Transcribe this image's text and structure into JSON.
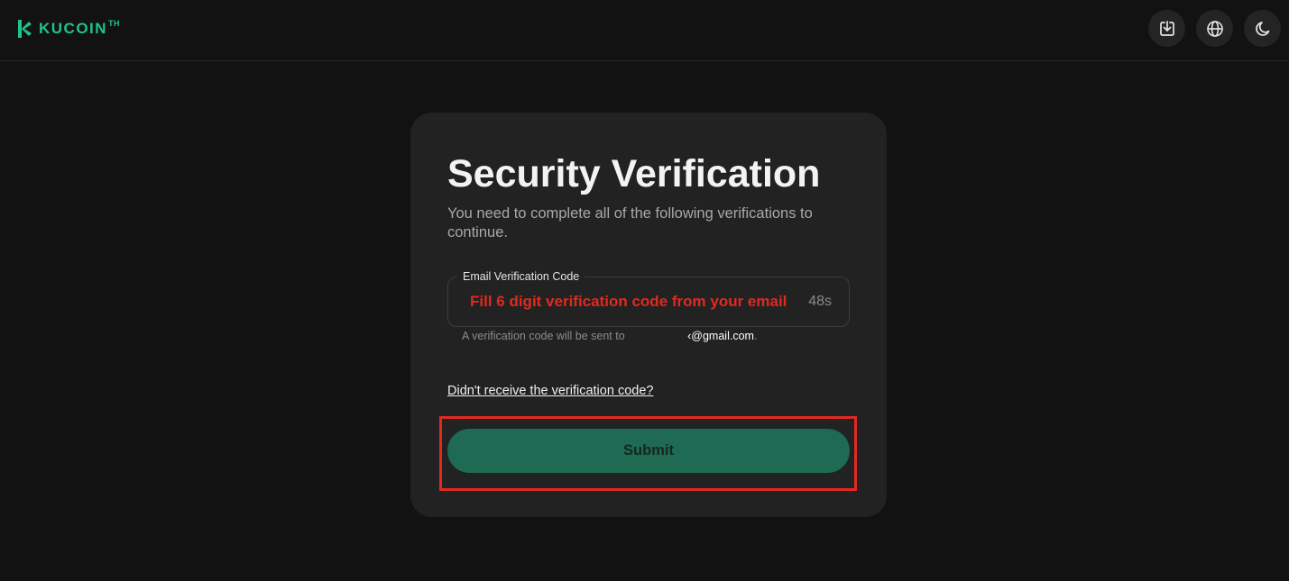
{
  "header": {
    "logo_text": "KUCOIN",
    "logo_suffix": "TH",
    "actions": [
      {
        "name": "download-icon"
      },
      {
        "name": "globe-icon"
      },
      {
        "name": "moon-icon"
      }
    ]
  },
  "verification": {
    "title": "Security Verification",
    "subtitle": "You need to complete all of the following verifications to continue.",
    "email_field": {
      "label": "Email Verification Code",
      "placeholder": "Fill 6 digit verification code from your email",
      "value": "",
      "countdown": "48s"
    },
    "helper_prefix": "A verification code will be sent to ",
    "helper_email": "‹@gmail.com",
    "helper_suffix": ".",
    "resend_link": "Didn't receive the verification code?",
    "submit_label": "Submit"
  },
  "colors": {
    "accent": "#1ec38e",
    "submit_bg": "#1e6a53",
    "annotation_red": "#e02a1f"
  }
}
